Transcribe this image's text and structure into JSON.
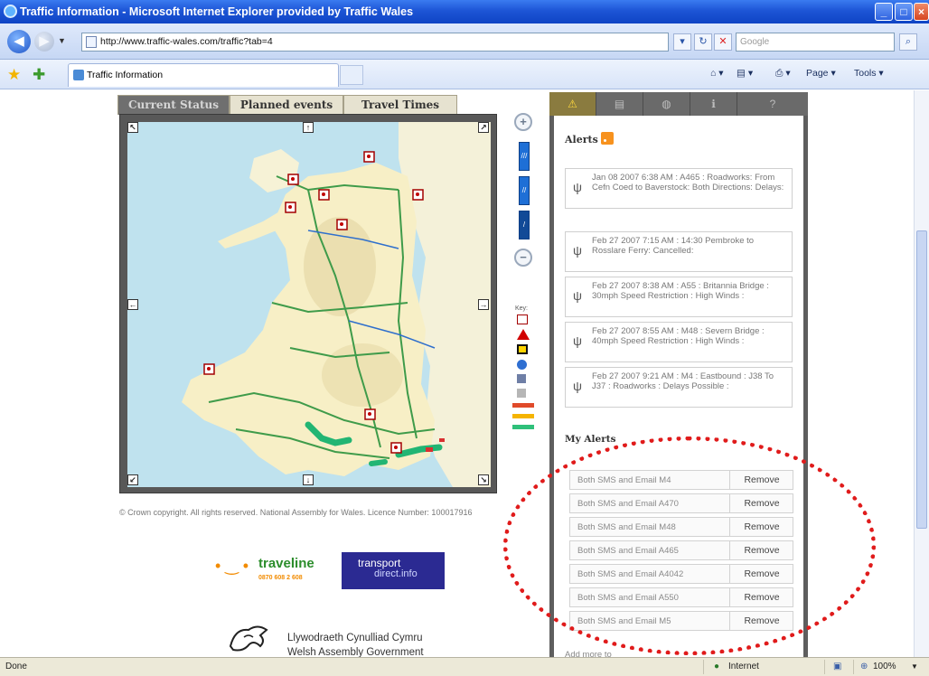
{
  "window": {
    "title": "Traffic Information - Microsoft Internet Explorer provided by Traffic Wales",
    "minimize": "_",
    "maximize": "□",
    "close": "×"
  },
  "address_bar": {
    "url": "http://www.traffic-wales.com/traffic?tab=4",
    "search_placeholder": "Google"
  },
  "tabs": [
    {
      "label": "Traffic Information"
    }
  ],
  "commands": {
    "page": "Page",
    "tools": "Tools"
  },
  "map": {
    "tabs": [
      "Current Status",
      "Planned events",
      "Travel Times"
    ],
    "key_label": "Key:",
    "copyright": "© Crown copyright. All rights reserved. National Assembly for Wales. Licence Number: 100017916"
  },
  "logos": {
    "traveline_name": "traveline",
    "traveline_number": "0870 608 2 608",
    "transport_direct_1": "transport",
    "transport_direct_2": "direct.info",
    "wag_line1": "Llywodraeth Cynulliad Cymru",
    "wag_line2": "Welsh Assembly Government"
  },
  "panel": {
    "alerts_heading": "Alerts",
    "alerts": [
      {
        "text": "Jan 08 2007 6:38 AM : A465 : Roadworks: From Cefn Coed to Baverstock: Both Directions: Delays:"
      },
      {
        "text": "Feb 27 2007 7:15 AM : 14:30 Pembroke to Rosslare Ferry: Cancelled:"
      },
      {
        "text": "Feb 27 2007 8:38 AM : A55 : Britannia Bridge : 30mph Speed Restriction : High Winds :"
      },
      {
        "text": "Feb 27 2007 8:55 AM : M48 : Severn Bridge : 40mph Speed Restriction : High Winds :"
      },
      {
        "text": "Feb 27 2007 9:21 AM : M4 : Eastbound : J38 To J37 : Roadworks : Delays Possible :"
      }
    ],
    "my_alerts_heading": "My Alerts",
    "my_alerts": [
      {
        "label": "Both SMS and Email M4",
        "action": "Remove"
      },
      {
        "label": "Both SMS and Email A470",
        "action": "Remove"
      },
      {
        "label": "Both SMS and Email M48",
        "action": "Remove"
      },
      {
        "label": "Both SMS and Email A465",
        "action": "Remove"
      },
      {
        "label": "Both SMS and Email A4042",
        "action": "Remove"
      },
      {
        "label": "Both SMS and Email A550",
        "action": "Remove"
      },
      {
        "label": "Both SMS and Email M5",
        "action": "Remove"
      }
    ],
    "add_more": "Add more to"
  },
  "status": {
    "left": "Done",
    "zone": "Internet",
    "zoom": "100%"
  },
  "colors": {
    "highlight": "#e01b1b",
    "titlebar": "#1d55d6",
    "panel": "#5e5e5e"
  }
}
